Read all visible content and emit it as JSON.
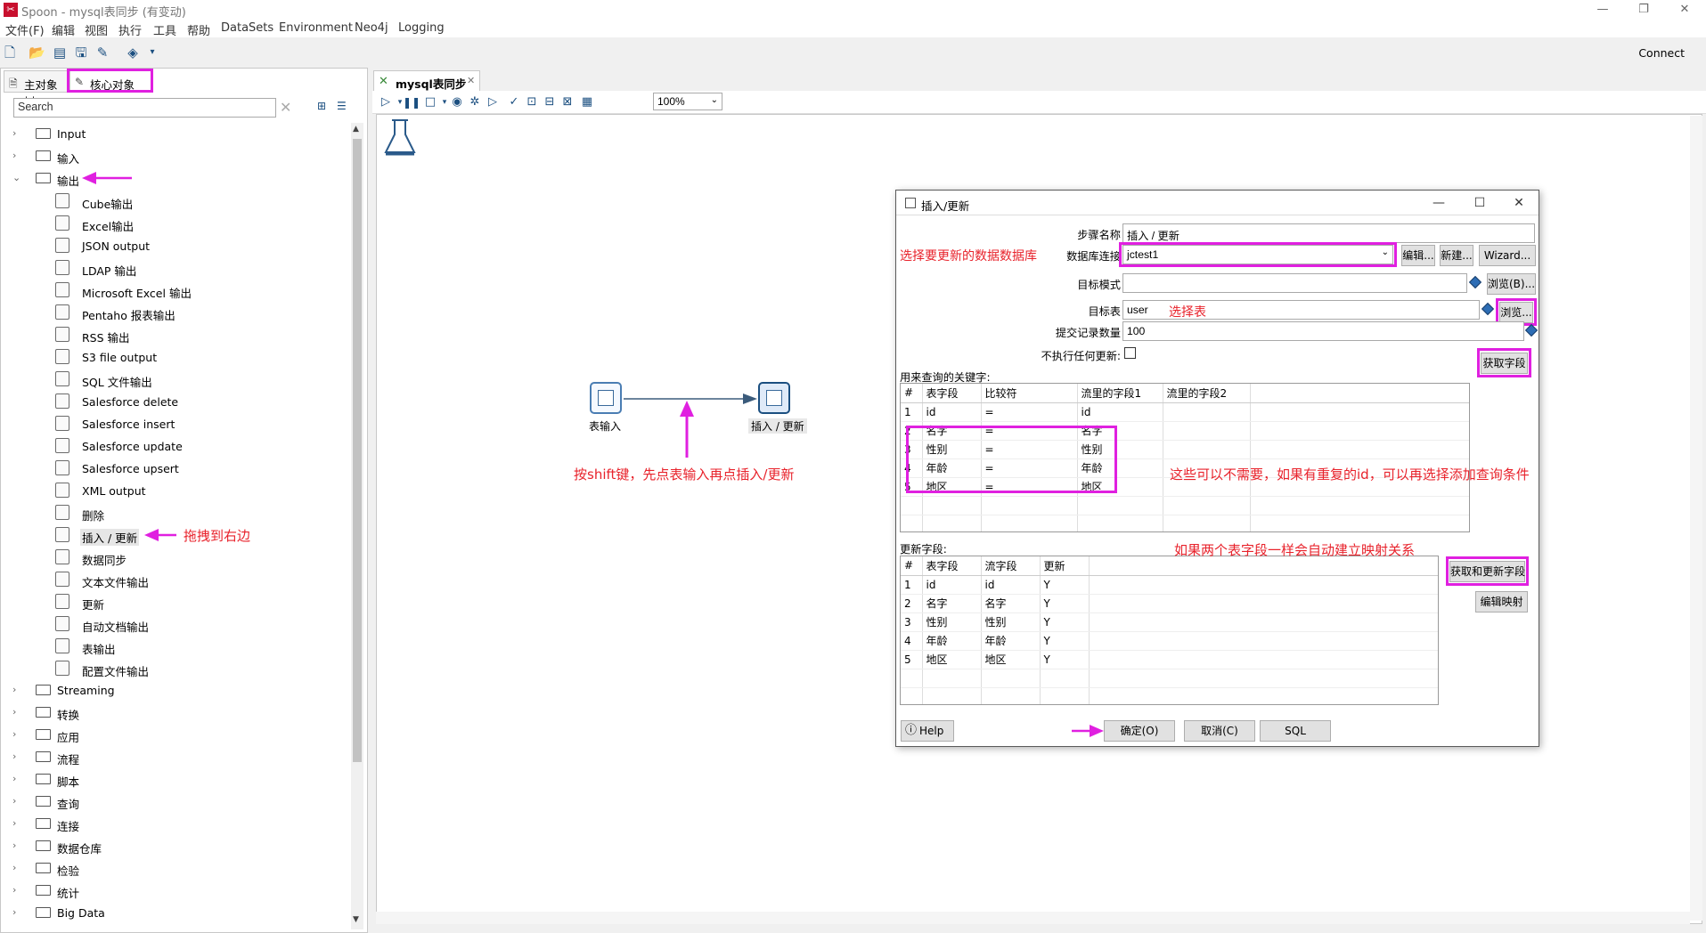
{
  "window": {
    "title": "Spoon - mysql表同步 (有变动)",
    "min": "—",
    "max": "❐",
    "close": "✕"
  },
  "menu": [
    "文件(F)",
    "编辑",
    "视图",
    "执行",
    "工具",
    "帮助",
    "DataSets",
    "Environment",
    "Neo4j",
    "Logging"
  ],
  "toolbar": {
    "connect": "Connect"
  },
  "left": {
    "tabs": [
      "主对象树",
      "核心对象"
    ],
    "search_placeholder": "Search",
    "folders_top": [
      "Input",
      "输入",
      "输出"
    ],
    "output_children": [
      "Cube输出",
      "Excel输出",
      "JSON output",
      "LDAP 输出",
      "Microsoft Excel 输出",
      "Pentaho 报表输出",
      "RSS 输出",
      "S3 file output",
      "SQL 文件输出",
      "Salesforce delete",
      "Salesforce insert",
      "Salesforce update",
      "Salesforce upsert",
      "XML output",
      "删除",
      "插入 / 更新",
      "数据同步",
      "文本文件输出",
      "更新",
      "自动文档输出",
      "表输出",
      "配置文件输出"
    ],
    "folders_bottom": [
      "Streaming",
      "转换",
      "应用",
      "流程",
      "脚本",
      "查询",
      "连接",
      "数据仓库",
      "检验",
      "统计",
      "Big Data"
    ]
  },
  "canvas": {
    "tab": "mysql表同步",
    "zoom": "100%",
    "steps": [
      {
        "name": "表输入"
      },
      {
        "name": "插入 / 更新"
      }
    ],
    "annotations": {
      "shift": "按shift键，先点表输入再点插入/更新",
      "drag": "拖拽到右边"
    }
  },
  "dialog": {
    "title": "插入/更新",
    "step_name_label": "步骤名称",
    "step_name": "插入 / 更新",
    "conn_label": "数据库连接",
    "conn_value": "jctest1",
    "edit_btn": "编辑...",
    "new_btn": "新建...",
    "wizard_btn": "Wizard...",
    "schema_label": "目标模式",
    "schema_value": "",
    "browse_b": "浏览(B)...",
    "table_label": "目标表",
    "table_value": "user",
    "browse": "浏览...",
    "commit_label": "提交记录数量",
    "commit_value": "100",
    "noupdate_label": "不执行任何更新:",
    "keys_label": "用来查询的关键字:",
    "keys_headers": [
      "#",
      "表字段",
      "比较符",
      "流里的字段1",
      "流里的字段2"
    ],
    "keys_rows": [
      [
        "1",
        "id",
        "=",
        "id",
        ""
      ],
      [
        "2",
        "名字",
        "=",
        "名字",
        ""
      ],
      [
        "3",
        "性别",
        "=",
        "性别",
        ""
      ],
      [
        "4",
        "年龄",
        "=",
        "年龄",
        ""
      ],
      [
        "5",
        "地区",
        "=",
        "地区",
        ""
      ]
    ],
    "get_fields": "获取字段",
    "update_label": "更新字段:",
    "update_headers": [
      "#",
      "表字段",
      "流字段",
      "更新"
    ],
    "update_rows": [
      [
        "1",
        "id",
        "id",
        "Y"
      ],
      [
        "2",
        "名字",
        "名字",
        "Y"
      ],
      [
        "3",
        "性别",
        "性别",
        "Y"
      ],
      [
        "4",
        "年龄",
        "年龄",
        "Y"
      ],
      [
        "5",
        "地区",
        "地区",
        "Y"
      ]
    ],
    "get_update": "获取和更新字段",
    "edit_mapping": "编辑映射",
    "help": "Help",
    "ok": "确定(O)",
    "cancel": "取消(C)",
    "sql": "SQL",
    "annot_conn": "选择要更新的数据数据库",
    "annot_table": "选择表",
    "annot_keys": "这些可以不需要，如果有重复的id，可以再选择添加查询条件",
    "annot_map": "如果两个表字段一样会自动建立映射关系"
  },
  "colors": {
    "annotation": "#e8222b",
    "highlight": "#e020e0",
    "arrow": "#e020e0"
  }
}
